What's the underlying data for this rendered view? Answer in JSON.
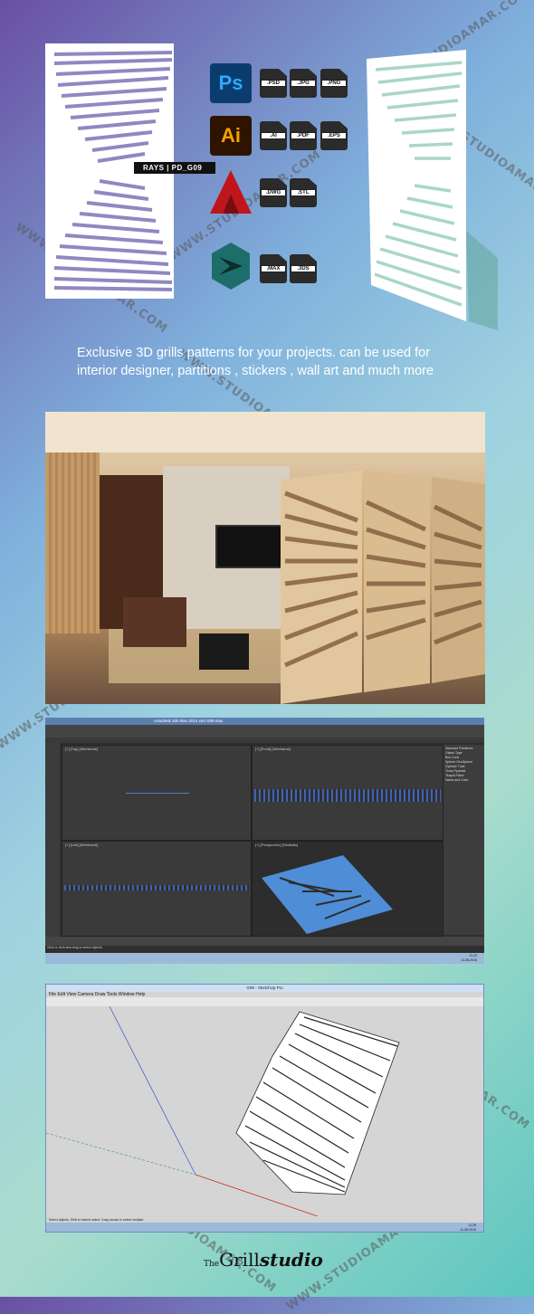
{
  "badge": "RAYS | PD_G09",
  "apps": [
    {
      "name": "photoshop-icon",
      "text": "Ps",
      "color": "#0a3d6e",
      "files": [
        ".PSD",
        ".JPG",
        ".PNG"
      ]
    },
    {
      "name": "illustrator-icon",
      "text": "Ai",
      "color": "#f2a100",
      "files": [
        ".AI",
        ".PDF",
        ".EPS"
      ]
    },
    {
      "name": "autocad-icon",
      "text": "A",
      "color": "#c0161b",
      "files": [
        ".DWG",
        ".STL"
      ]
    },
    {
      "name": "3dsmax-icon",
      "text": "3",
      "color": "#1d6e6b",
      "files": [
        ".MAX",
        ".3DS"
      ]
    }
  ],
  "tagline": {
    "line1": "Exclusive  3D grills patterns for your projects.  can be used for",
    "line2": "interior designer, partitions , stickers , wall art and much more"
  },
  "watermark": "WWW.STUDIOAMAR.COM",
  "max_window": {
    "title": "Autodesk 3ds Max 2014 x64      G09.max",
    "viewports": [
      "[+] [Top] [Wireframe]",
      "[+] [Front] [Wireframe]",
      "[+] [Left] [Wireframe]",
      "[+] [Perspective] [Realistic]"
    ],
    "command_panel": [
      "Standard Primitives",
      "Object Type",
      "Box",
      "Cone",
      "Sphere",
      "GeoSphere",
      "Cylinder",
      "Tube",
      "Torus",
      "Pyramid",
      "Teapot",
      "Plane",
      "Name and Color"
    ],
    "status": "Click or click-and-drag to select objects",
    "time": "11:22",
    "date": "11-08-2016"
  },
  "sketchup_window": {
    "title": "G09 - SketchUp Pro",
    "menus": [
      "File",
      "Edit",
      "View",
      "Camera",
      "Draw",
      "Tools",
      "Window",
      "Help"
    ],
    "status": "Select objects. Shift to extend select. Drag mouse to select multiple.",
    "time": "11:25",
    "date": "11-08-2016"
  },
  "logo": {
    "the": "The",
    "grill": "Grill",
    "studio": "studio"
  }
}
